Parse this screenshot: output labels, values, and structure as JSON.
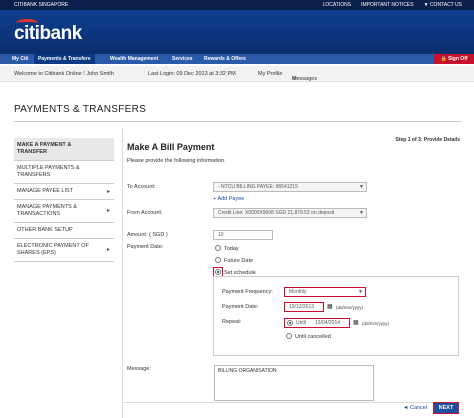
{
  "topbar": {
    "site": "CITIBANK SINGAPORE",
    "links": [
      "LOCATIONS",
      "IMPORTANT NOTICES",
      "▼ CONTACT US"
    ]
  },
  "brand": {
    "logo": "citibank"
  },
  "nav": {
    "tabs": [
      "My Citi",
      "Payments & Transfers",
      "Wealth Management",
      "Services",
      "Rewards & Offers"
    ],
    "active": "Payments & Transfers",
    "signoff": "Sign Off"
  },
  "welcome": {
    "greeting": "Welcome to Citibank Online ! John Smith",
    "last_login": "Last Login: 09 Dec 2013 at 3:32 PM",
    "profile": "My Profile",
    "messages": "Messages"
  },
  "section_title": "PAYMENTS & TRANSFERS",
  "sidebar": {
    "items": [
      "MAKE A PAYMENT & TRANSFER",
      "MULTIPLE PAYMENTS & TRANSFERS",
      "MANAGE PAYEE LIST",
      "MANAGE PAYMENTS & TRANSACTIONS",
      "OTHER BANK SETUP",
      "ELECTRONIC PAYMENT OF SHARES (EPS)"
    ]
  },
  "form": {
    "step": "Step 1 of 3: Provide Details",
    "title": "Make A Bill Payment",
    "subtitle": "Please provide the following information.",
    "to_account_label": "To Account:",
    "to_account_value": "- NTCU BILLING PAYEE: 96541215",
    "add_payee": "Add Payee",
    "from_account_label": "From Account:",
    "from_account_value": "Credit Line: X0000X9008  SGD 21,879.52  on deposit",
    "amount_label": "Amount:  ( SGD )",
    "amount_value": "10",
    "payment_date_label": "Payment Date:",
    "option_today": "Today",
    "option_future": "Future Date",
    "option_schedule": "Set schedule",
    "frequency_label": "Payment Frequency:",
    "frequency_value": "Monthly",
    "schedule_date_label": "Payment Date:",
    "schedule_date_value": "13/12/2013",
    "date_format": "(dd/mm/yyyy)",
    "repeat_label": "Repeat:",
    "until_label": "Until",
    "until_value": "13/04/2014",
    "until_cancelled": "Until cancelled",
    "message_label": "Message:",
    "message_value": "BILLING ORGANISATION",
    "cancel": "◄ Cancel",
    "next": "NEXT"
  },
  "colors": {
    "brand_blue": "#0f3f8f",
    "accent_red": "#c8102e"
  }
}
